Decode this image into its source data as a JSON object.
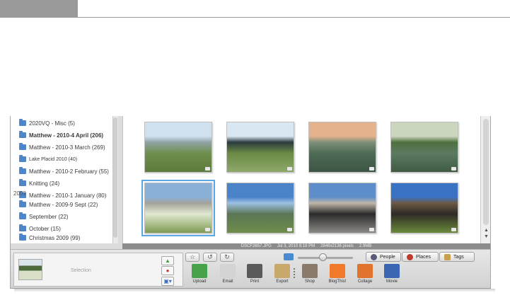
{
  "sidebar": {
    "items": [
      {
        "label": "2020VQ - Misc (5)",
        "style": "normal"
      },
      {
        "label": "Matthew - 2010-4 April (206)",
        "style": "bold"
      },
      {
        "label": "Matthew - 2010-3 March (269)",
        "style": "normal"
      },
      {
        "label": "Lake Placid 2010 (40)",
        "style": "small"
      },
      {
        "label": "Matthew - 2010-2 February (55)",
        "style": "normal"
      },
      {
        "label": "Knitting (24)",
        "style": "normal"
      },
      {
        "label": "Matthew - 2010-1 January (80)",
        "style": "normal"
      }
    ],
    "year_header": "2009",
    "items_2009": [
      {
        "label": "Matthew - 2009-9 Sept (22)"
      },
      {
        "label": "September (22)"
      },
      {
        "label": "October (15)"
      },
      {
        "label": "Christmas 2009 (99)"
      }
    ]
  },
  "photos": [
    {
      "name": "photo-mountain-trail",
      "colors": [
        "#cfe0ef",
        "#8fa3a4",
        "#6f8f4e",
        "#5d7b3a"
      ]
    },
    {
      "name": "photo-wildflower-field",
      "colors": [
        "#d9e7f2",
        "#2a3a3e",
        "#6b8a44",
        "#8ea86a"
      ]
    },
    {
      "name": "photo-lake-sunset",
      "colors": [
        "#e4b28c",
        "#7d8f79",
        "#4d6b55",
        "#3d5544"
      ]
    },
    {
      "name": "photo-lake-trees",
      "colors": [
        "#cbd6bf",
        "#4e6f3d",
        "#5c7a62",
        "#3f5b44"
      ]
    },
    {
      "name": "photo-lodge-meadow",
      "colors": [
        "#8ab0d8",
        "#a4a29a",
        "#dfe8d0",
        "#7f9a52"
      ]
    },
    {
      "name": "photo-valley-hills",
      "colors": [
        "#4b83c9",
        "#9dc1e3",
        "#5a7656",
        "#6f8d4a"
      ]
    },
    {
      "name": "photo-adirondack-chairs",
      "colors": [
        "#5e8ec9",
        "#bfb7a8",
        "#2b2b2b",
        "#8c8a86"
      ]
    },
    {
      "name": "photo-lodge-building",
      "colors": [
        "#3a72c4",
        "#6e5a44",
        "#2e2a26",
        "#6b8a3c"
      ]
    }
  ],
  "infobar": {
    "filename": "DSCF2657.JPG",
    "date": "Jul 3, 2010 8:18 PM",
    "dimensions": "2848x2136 pixels",
    "size": "2.9MB"
  },
  "tray": {
    "selection_label": "Selection",
    "pills": {
      "people": "People",
      "places": "Places",
      "tags": "Tags"
    },
    "actions": [
      {
        "label": "Upload",
        "icon": "upload-icon",
        "color": "#46a34a"
      },
      {
        "label": "Email",
        "icon": "email-icon",
        "color": "#d4d4d4"
      },
      {
        "label": "Print",
        "icon": "print-icon",
        "color": "#5a5a5a"
      },
      {
        "label": "Export",
        "icon": "export-folder-icon",
        "color": "#c9a86b"
      },
      {
        "label": "Shop",
        "icon": "shop-icon",
        "color": "#8a7a6a"
      },
      {
        "label": "BlogThis!",
        "icon": "blogger-icon",
        "color": "#f07a2a"
      },
      {
        "label": "Collage",
        "icon": "collage-icon",
        "color": "#e0742e"
      },
      {
        "label": "Movie",
        "icon": "movie-icon",
        "color": "#3a66b3"
      }
    ]
  },
  "colors": {
    "accent": "#5aa7e6",
    "folder": "#4f86c9"
  }
}
